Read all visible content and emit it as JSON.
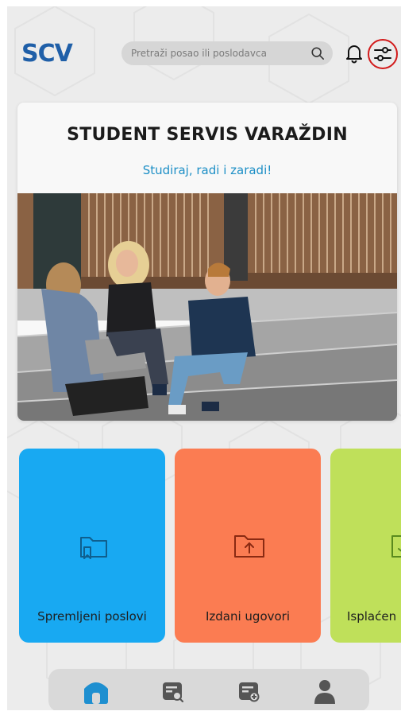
{
  "header": {
    "logo_text": "SCV",
    "search_placeholder": "Pretraži posao ili poslodavca",
    "icons": [
      "search-icon",
      "bell-icon",
      "filter-sliders-icon"
    ]
  },
  "hero": {
    "title": "STUDENT SERVIS VARAŽDIN",
    "subtitle": "Studiraj, radi i zaradi!"
  },
  "tiles": [
    {
      "label": "Spremljeni poslovi",
      "color": "#18a9f2",
      "icon": "bookmark-folder-icon"
    },
    {
      "label": "Izdani ugovori",
      "color": "#fb7c52",
      "icon": "upload-folder-icon"
    },
    {
      "label": "Isplaćen",
      "color": "#bfe05a",
      "icon": "check-folder-icon"
    }
  ],
  "bottom_nav": [
    {
      "icon": "home-icon",
      "active": true
    },
    {
      "icon": "job-search-icon",
      "active": false
    },
    {
      "icon": "add-job-icon",
      "active": false
    },
    {
      "icon": "profile-icon",
      "active": false
    }
  ],
  "colors": {
    "brand": "#1f5fa8",
    "accent_blue": "#18a9f2",
    "accent_orange": "#fb7c52",
    "accent_green": "#bfe05a",
    "subtitle": "#1d8fc6",
    "filter_highlight": "#d21a1a"
  }
}
